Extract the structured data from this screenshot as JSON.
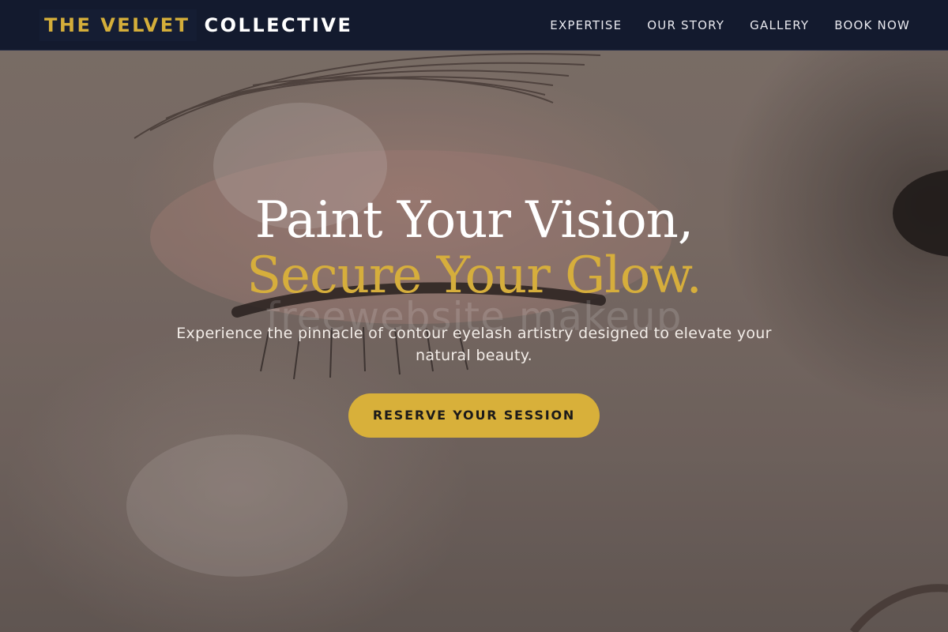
{
  "header": {
    "logo": {
      "part_1": "THE VELVET",
      "part_2": "COLLECTIVE"
    },
    "nav": [
      {
        "label": "EXPERTISE"
      },
      {
        "label": "OUR STORY"
      },
      {
        "label": "GALLERY"
      },
      {
        "label": "BOOK NOW"
      }
    ]
  },
  "hero": {
    "headline_line_1": "Paint Your Vision,",
    "headline_line_2": "Secure Your Glow.",
    "subtitle": "Experience the pinnacle of contour eyelash artistry designed to elevate your natural beauty.",
    "cta_label": "RESERVE YOUR SESSION",
    "watermark": "freewebsite makeup",
    "image_description_icon": "close-up-eye-photo"
  },
  "colors": {
    "header_bg": "#131a2e",
    "accent_gold": "#d6ae3c",
    "headline_white": "#ffffff",
    "cta_text": "#1c1a1a"
  }
}
